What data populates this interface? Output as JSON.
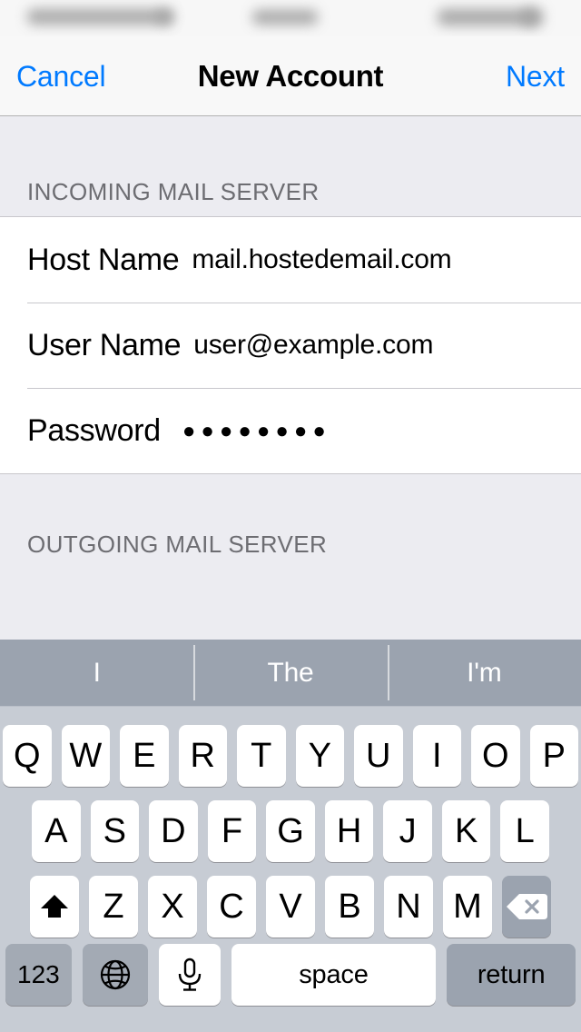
{
  "status_bar": {
    "redacted": true,
    "note": "blurred"
  },
  "nav": {
    "cancel_label": "Cancel",
    "title": "New Account",
    "next_label": "Next",
    "accent_color": "#007AFF"
  },
  "sections": [
    {
      "header": "INCOMING MAIL SERVER",
      "rows": [
        {
          "label": "Host Name",
          "value": "mail.hostedemail.com",
          "type": "text"
        },
        {
          "label": "User Name",
          "value": "user@example.com",
          "type": "text"
        },
        {
          "label": "Password",
          "value": "●●●●●●●●",
          "type": "password"
        }
      ]
    },
    {
      "header": "OUTGOING MAIL SERVER",
      "rows": []
    }
  ],
  "keyboard": {
    "suggestions": [
      "I",
      "The",
      "I'm"
    ],
    "row1": [
      "Q",
      "W",
      "E",
      "R",
      "T",
      "Y",
      "U",
      "I",
      "O",
      "P"
    ],
    "row2": [
      "A",
      "S",
      "D",
      "F",
      "G",
      "H",
      "J",
      "K",
      "L"
    ],
    "row3": [
      "Z",
      "X",
      "C",
      "V",
      "B",
      "N",
      "M"
    ],
    "shift_icon": "shift-icon",
    "delete_icon": "delete-icon",
    "numbers_label": "123",
    "globe_icon": "globe-icon",
    "mic_icon": "microphone-icon",
    "space_label": "space",
    "return_label": "return",
    "background_color": "#C7CCD4",
    "suggestion_bar_color": "#9BA3AF",
    "shift_active": true
  }
}
